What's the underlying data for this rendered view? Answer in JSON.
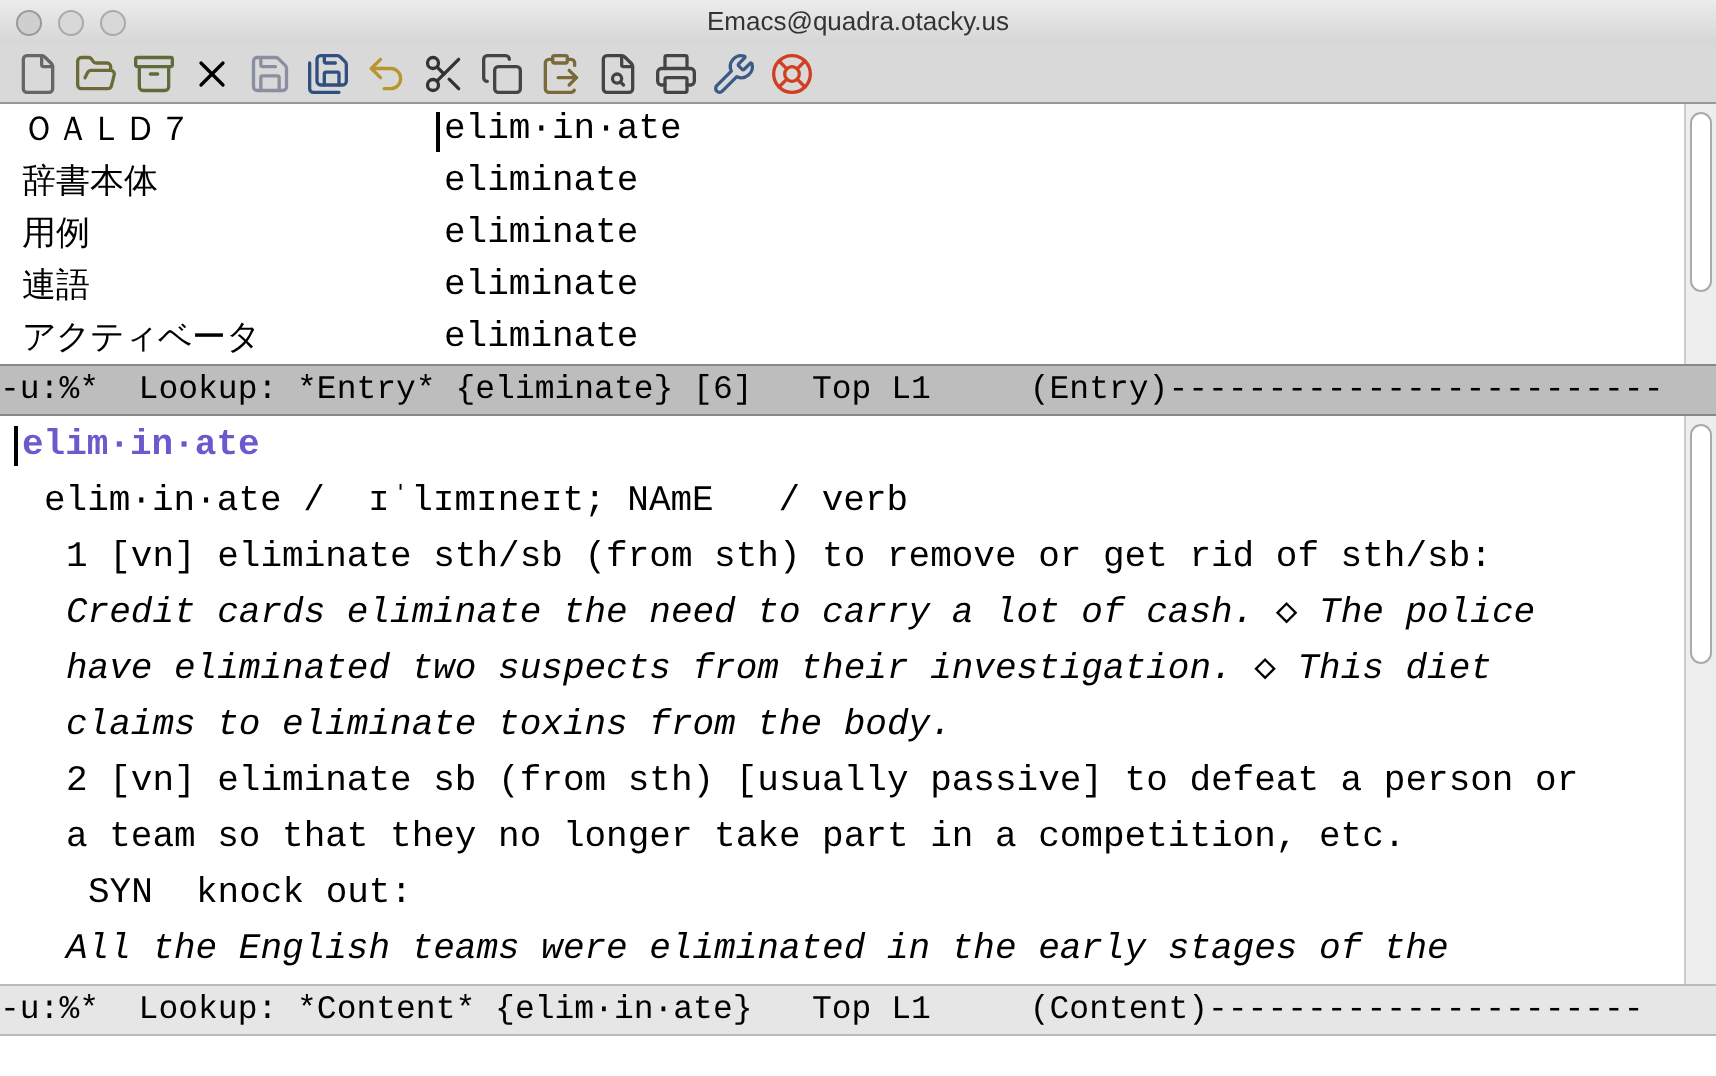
{
  "window": {
    "title": "Emacs@quadra.otacky.us"
  },
  "entry_pane": {
    "rows": [
      {
        "label": "ＯＡＬＤ７",
        "word": "elim·in·ate",
        "cursor": true
      },
      {
        "label": "辞書本体",
        "word": "eliminate",
        "cursor": false
      },
      {
        "label": "用例",
        "word": "eliminate",
        "cursor": false
      },
      {
        "label": "連語",
        "word": "eliminate",
        "cursor": false
      },
      {
        "label": "アクティベータ",
        "word": "eliminate",
        "cursor": false
      }
    ],
    "mode_line": {
      "active": true,
      "text": "-u:%*  Lookup: *Entry* {eliminate} [6]   Top L1     (Entry)-------------------------"
    }
  },
  "content_pane": {
    "lines": [
      {
        "kind": "headword",
        "text": "elim·in·ate",
        "cursor": true
      },
      {
        "kind": "pron",
        "text": "elim·in·ate /  ɪˈlɪmɪneɪt; NAmE   / verb",
        "cursor": false
      },
      {
        "kind": "sense",
        "text": "1 [vn] eliminate sth/sb (from sth) to remove or get rid of sth/sb:",
        "cursor": false
      },
      {
        "kind": "example",
        "text": "Credit cards eliminate the need to carry a lot of cash. ◇ The police",
        "cursor": false
      },
      {
        "kind": "example",
        "text": "have eliminated two suspects from their investigation. ◇ This diet",
        "cursor": false
      },
      {
        "kind": "example",
        "text": "claims to eliminate toxins from the body.",
        "cursor": false
      },
      {
        "kind": "sense",
        "text": "2 [vn] eliminate sb (from sth) [usually passive] to defeat a person or",
        "cursor": false
      },
      {
        "kind": "sense",
        "text": "a team so that they no longer take part in a competition, etc.",
        "cursor": false
      },
      {
        "kind": "syn",
        "text": "SYN  knock out:",
        "cursor": false
      },
      {
        "kind": "example",
        "text": "All the English teams were eliminated in the early stages of the",
        "cursor": false
      }
    ],
    "mode_line": {
      "active": false,
      "text": "-u:%*  Lookup: *Content* {elim·in·ate}   Top L1     (Content)----------------------"
    }
  }
}
